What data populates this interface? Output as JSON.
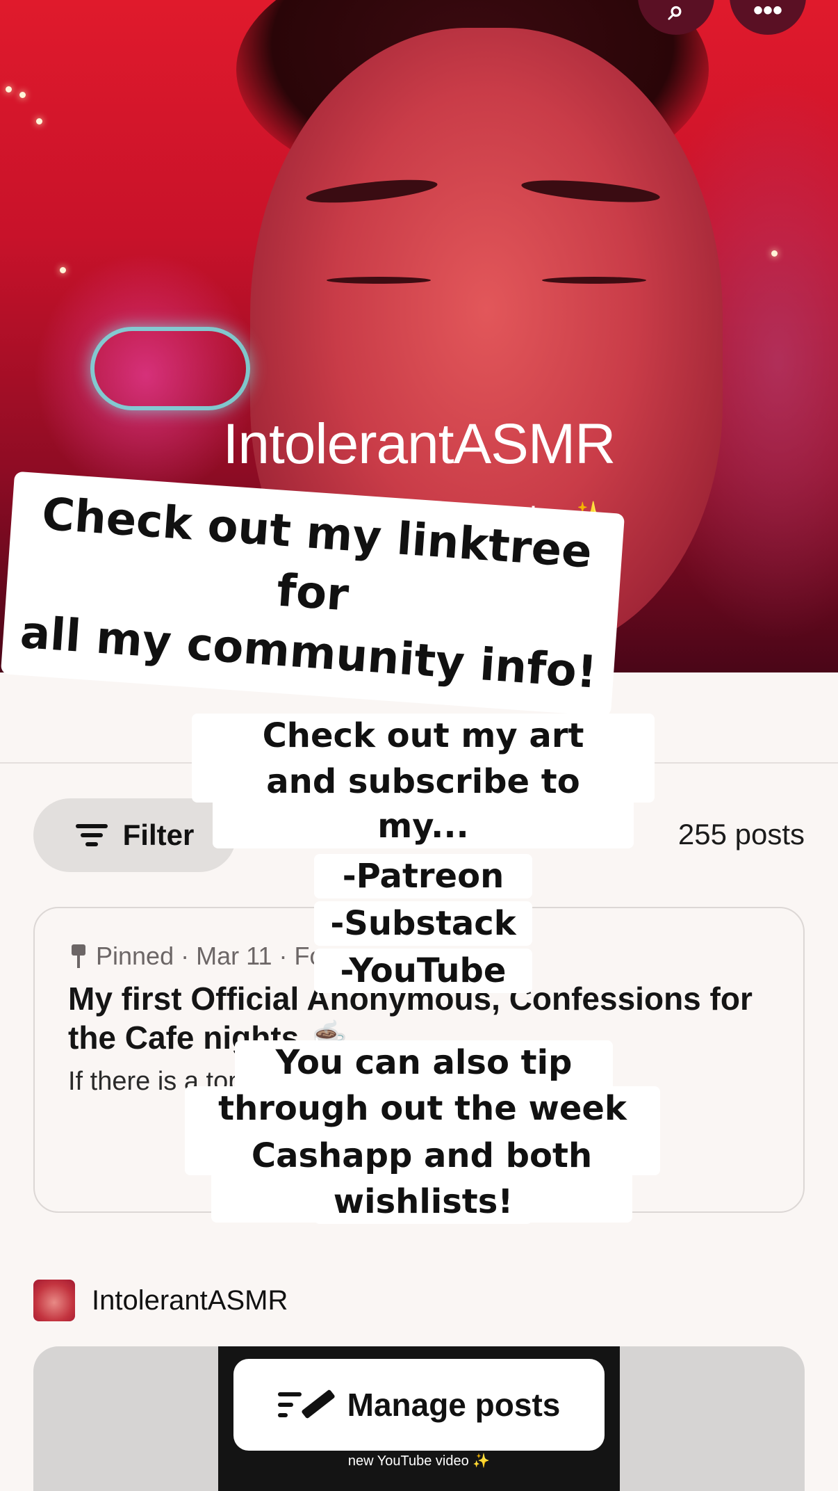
{
  "profile": {
    "name": "IntolerantASMR",
    "subtitle": "My Amazing Community ✨"
  },
  "header_actions": {
    "search_icon": "search-icon",
    "more_icon": "more-icon"
  },
  "overlay_captions": {
    "linktree": [
      "Check out my linktree for",
      "all my community  info!"
    ],
    "art": [
      "Check out my art pieces",
      "and subscribe to my..."
    ],
    "platforms": [
      "-Patreon",
      "-Substack",
      "-YouTube"
    ],
    "tips": [
      "You can also tip me",
      "through out the week via",
      "Cashapp and both my",
      "wishlists!"
    ]
  },
  "feed": {
    "filter_label": "Filter",
    "post_count": "255 posts"
  },
  "pinned_post": {
    "meta": "Pinned · Mar 11 · Fo",
    "title": "My first Official Anonymous, Confessions for the Cafe nights ☕",
    "excerpt": "If there is a topic you'd like us to discuss duri..."
  },
  "next_post": {
    "author": "IntolerantASMR",
    "video_caption": "new YouTube video ✨"
  },
  "manage_button_label": "Manage posts"
}
